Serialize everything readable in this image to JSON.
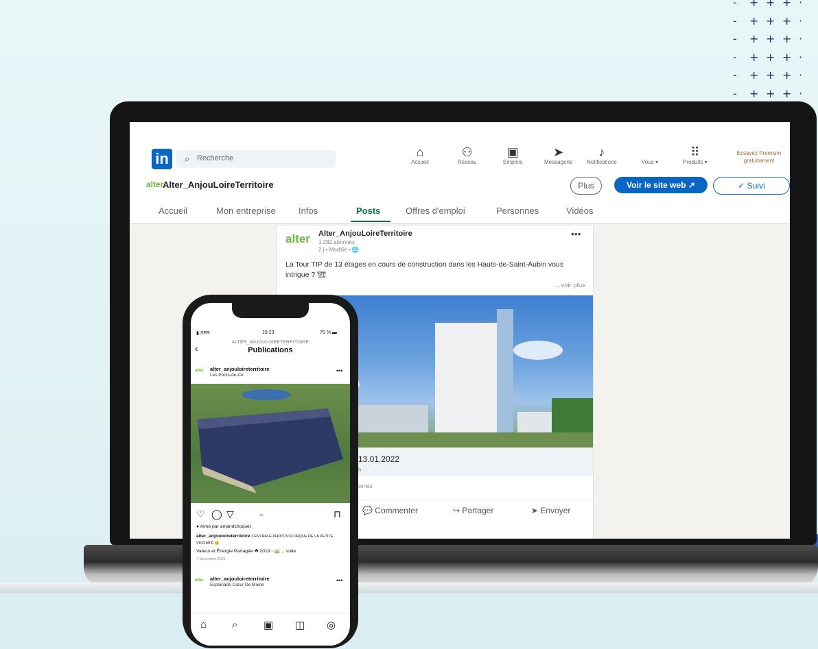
{
  "linkedin": {
    "search_placeholder": "Recherche",
    "nav": [
      {
        "icon": "home-icon",
        "label": "Accueil"
      },
      {
        "icon": "network-icon",
        "label": "Réseau"
      },
      {
        "icon": "briefcase-icon",
        "label": "Emplois"
      },
      {
        "icon": "send-icon",
        "label": "Messagerie"
      },
      {
        "icon": "bell-icon",
        "label": "Notifications"
      },
      {
        "icon": "avatar-icon",
        "label": "Vous ▾"
      },
      {
        "icon": "grid-icon",
        "label": "Produits ▾"
      }
    ],
    "premium": "Essayez Premium gratuitement",
    "company_name": "Alter_AnjouLoireTerritoire",
    "company_logo": "alter",
    "more_button": "Plus",
    "website_button": "Voir le site web",
    "follow_button": "✓ Suivi",
    "tabs": [
      "Accueil",
      "Mon entreprise",
      "Infos",
      "Posts",
      "Offres d'emploi",
      "Personnes",
      "Vidéos"
    ],
    "active_tab": "Posts",
    "post": {
      "author": "Alter_AnjouLoireTerritoire",
      "followers": "1 282 abonnés",
      "time": "2 j • Modifié • 🌐",
      "text": "La Tour TIP de 13 étages en cours de construction dans les Hauts-de-Saint-Aubin vous intrigue ? 🏗",
      "see_more": "…voir plus",
      "date_caption": "13.01.2022",
      "caption_sub": "n",
      "reactions": "rsonnes",
      "actions": [
        "Commenter",
        "Partager",
        "Envoyer"
      ]
    }
  },
  "instagram": {
    "status": {
      "carrier": "SFR",
      "time": "15:23",
      "battery": "75 %"
    },
    "header_user": "ALTER_ANJOULOIRETERRITOIRE",
    "header_title": "Publications",
    "post1": {
      "user": "alter_anjouloireterritoire",
      "location": "Les Ponts-de-Cé"
    },
    "liked_by": "Aimé par amandchoquet",
    "caption_user": "alter_anjouloireterritoire",
    "caption_title": "CENTRALE PHOTOVOLTAÏQUE DE LA PETITE VICOMTÉ 😊",
    "caption_line": "Valeco et Énergie Partagée ☘ 2019 - 🚃… suite",
    "caption_date": "7 décembre 2021",
    "post2": {
      "user": "alter_anjouloireterritoire",
      "location": "Esplanade Cœur De Maine"
    }
  }
}
